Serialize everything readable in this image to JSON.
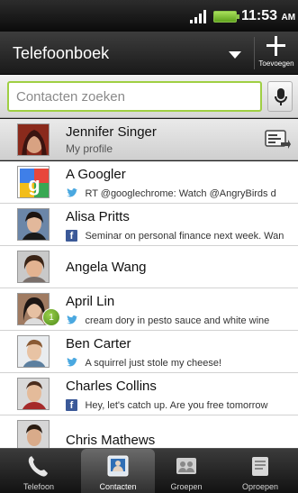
{
  "status_bar": {
    "time": "11:53",
    "ampm": "AM"
  },
  "header": {
    "title": "Telefoonboek",
    "add_label": "Toevoegen"
  },
  "search": {
    "placeholder": "Contacten zoeken"
  },
  "profile": {
    "name": "Jennifer Singer",
    "subtitle": "My profile"
  },
  "contacts": [
    {
      "name": "A Googler",
      "source": "twitter-icon",
      "status": "RT @googlechrome: Watch @AngryBirds d",
      "avatar": "google-logo"
    },
    {
      "name": "Alisa Pritts",
      "source": "facebook-icon",
      "status": "Seminar on personal finance next week. Wan",
      "avatar": "photo"
    },
    {
      "name": "Angela Wang",
      "source": "",
      "status": "",
      "avatar": "photo"
    },
    {
      "name": "April Lin",
      "source": "twitter-icon",
      "status": "cream dory in pesto sauce and white wine",
      "avatar": "photo",
      "badge": "1"
    },
    {
      "name": "Ben Carter",
      "source": "twitter-icon",
      "status": "A squirrel just stole my cheese!",
      "avatar": "photo"
    },
    {
      "name": "Charles Collins",
      "source": "facebook-icon",
      "status": "Hey, let's catch up. Are you free tomorrow",
      "avatar": "photo"
    },
    {
      "name": "Chris Mathews",
      "source": "",
      "status": "",
      "avatar": "photo"
    }
  ],
  "tabs": [
    {
      "label": "Telefoon",
      "icon": "phone-icon",
      "active": false
    },
    {
      "label": "Contacten",
      "icon": "contacts-icon",
      "active": true
    },
    {
      "label": "Groepen",
      "icon": "groups-icon",
      "active": false
    },
    {
      "label": "Oproepen",
      "icon": "call-log-icon",
      "active": false
    }
  ],
  "colors": {
    "accent": "#9fcf43",
    "facebook": "#3b5998",
    "twitter": "#4aa8e0"
  }
}
